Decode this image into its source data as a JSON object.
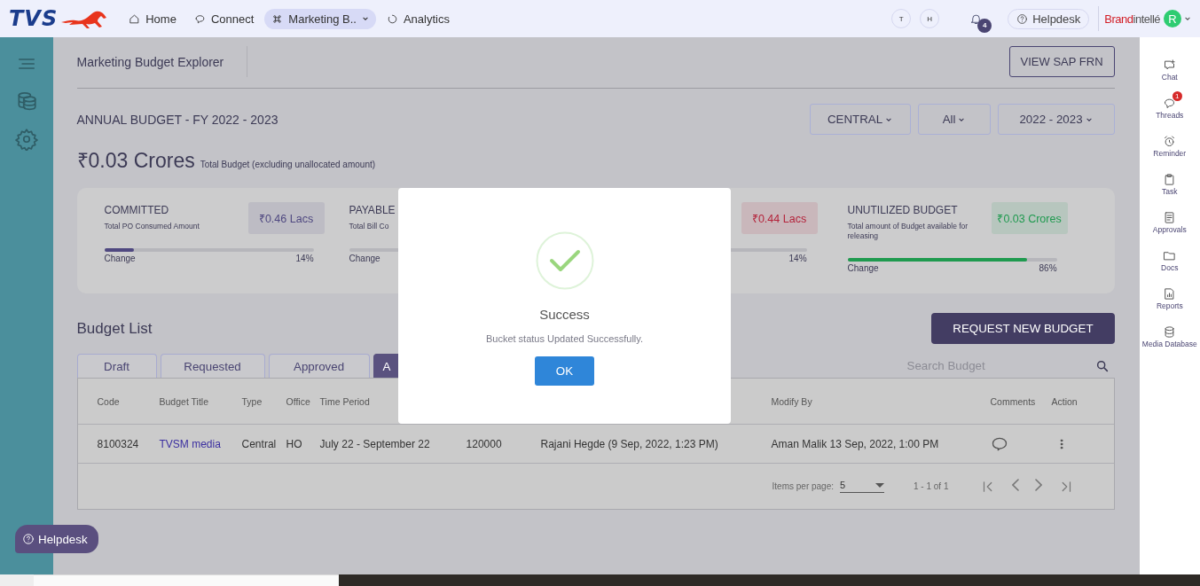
{
  "brand": {
    "logo_text": "TVS"
  },
  "nav": [
    {
      "label": "Home",
      "selected": false,
      "dropdown": false
    },
    {
      "label": "Connect",
      "selected": false,
      "dropdown": false
    },
    {
      "label": "Marketing B..",
      "selected": true,
      "dropdown": true
    },
    {
      "label": "Analytics",
      "selected": false,
      "dropdown": false
    }
  ],
  "user_initials": [
    "T",
    "H"
  ],
  "notifications": {
    "count": "4"
  },
  "helpdesk_link": "Helpdesk",
  "product": {
    "brand": "Brand",
    "suffix": "intellé"
  },
  "avatar": "R",
  "page": {
    "title": "Marketing Budget Explorer",
    "view_button": "VIEW SAP FRN",
    "annual_title": "ANNUAL BUDGET - FY 2022 - 2023",
    "filters": [
      "CENTRAL",
      "All",
      "2022 - 2023"
    ],
    "total": "₹0.03 Crores",
    "total_note": "Total Budget (excluding unallocated amount)"
  },
  "summary_cards": [
    {
      "title": "COMMITTED",
      "description": "Total PO Consumed Amount",
      "value": "₹0.46 Lacs",
      "color": "#4f4880",
      "level": 0.14,
      "change_label": "Change",
      "percent": "14%"
    },
    {
      "title": "PAYABLE",
      "description": "Total Bill Co",
      "change_label": "Change"
    },
    {
      "value": "₹0.44 Lacs",
      "color": "#b4233b",
      "percent": "14%"
    },
    {
      "title": "UNUTILIZED BUDGET",
      "description": "Total amount of Budget available for releasing",
      "value": "₹0.03 Crores",
      "color": "#1f9a4f",
      "level": 0.86,
      "change_label": "Change",
      "percent": "86%"
    }
  ],
  "budget_list": {
    "title": "Budget List",
    "request_button": "REQUEST NEW BUDGET",
    "tabs": [
      {
        "label": "Draft",
        "selected": false
      },
      {
        "label": "Requested",
        "selected": false
      },
      {
        "label": "Approved",
        "selected": false
      },
      {
        "label": "A",
        "selected": true
      }
    ],
    "search": {
      "placeholder": "Search Budget"
    }
  },
  "table": {
    "columns": [
      {
        "label": "Code"
      },
      {
        "label": "Budget Title"
      },
      {
        "label": "Type"
      },
      {
        "label": "Office"
      },
      {
        "label": "Time Period"
      },
      {},
      {},
      {
        "label": "Modify By"
      },
      {
        "label": "Comments"
      },
      {
        "label": "Action"
      }
    ],
    "rows": [
      {
        "cells": [
          {
            "kind": "text",
            "text": "8100324"
          },
          {
            "kind": "link",
            "text": "TVSM media"
          },
          {
            "kind": "text",
            "text": "Central"
          },
          {
            "kind": "text",
            "text": "HO"
          },
          {
            "kind": "text",
            "text": "July 22 - September 22"
          },
          {
            "kind": "text",
            "text": "120000"
          },
          {
            "kind": "text",
            "text": "Rajani Hegde (9 Sep, 2022, 1:23 PM)"
          },
          {
            "kind": "text",
            "text": "Aman Malik 13 Sep, 2022, 1:00 PM"
          },
          {
            "kind": "comment"
          },
          {
            "kind": "menu"
          }
        ]
      }
    ]
  },
  "pagination": {
    "items_per_page_label": "Items per page:",
    "page_size": "5",
    "range": "1 - 1 of 1"
  },
  "floating_helpdesk": "Helpdesk",
  "right_rail": [
    {
      "label": "Chat"
    },
    {
      "label": "Threads",
      "badge": "1"
    },
    {
      "label": "Reminder"
    },
    {
      "label": "Task"
    },
    {
      "label": "Approvals"
    },
    {
      "label": "Docs"
    },
    {
      "label": "Reports"
    },
    {
      "label": "Media Database"
    }
  ],
  "dialog": {
    "title": "Success",
    "message": "Bucket status Updated Successfully.",
    "button": "OK"
  }
}
